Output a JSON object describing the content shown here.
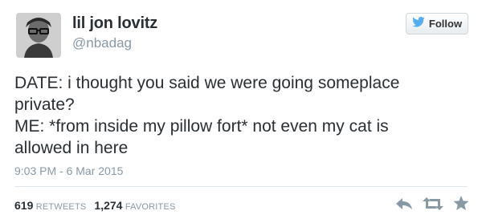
{
  "user": {
    "display_name": "lil jon lovitz",
    "handle": "@nbadag",
    "avatar_icon": "profile-photo"
  },
  "follow_button": {
    "label": "Follow",
    "icon": "twitter-bird-icon",
    "icon_color": "#55acee"
  },
  "tweet": {
    "lines": [
      "DATE: i thought you said we were going someplace",
      "private?",
      "ME: *from inside my pillow fort* not even my cat is",
      "allowed in here"
    ],
    "timestamp": "9:03 PM - 6 Mar 2015"
  },
  "stats": {
    "retweets_count": "619",
    "retweets_label": "RETWEETS",
    "favorites_count": "1,274",
    "favorites_label": "FAVORITES"
  },
  "actions": [
    "reply-icon",
    "retweet-icon",
    "favorite-icon"
  ]
}
